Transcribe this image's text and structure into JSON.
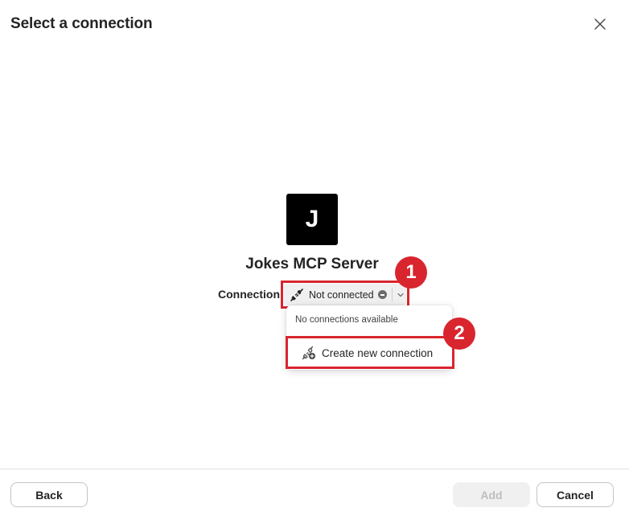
{
  "dialog": {
    "title": "Select a connection"
  },
  "server": {
    "logo_letter": "J",
    "name": "Jokes MCP Server"
  },
  "connection": {
    "label": "Connection",
    "status": "Not connected",
    "status_icon": "minus-circle-icon",
    "plug_icon": "plug-disconnected-icon"
  },
  "menu": {
    "empty_message": "No connections available",
    "create_label": "Create new connection",
    "create_icon": "plug-add-icon"
  },
  "annotations": {
    "badge_1": "1",
    "badge_2": "2",
    "highlight_color": "#d9252e"
  },
  "footer": {
    "back_label": "Back",
    "add_label": "Add",
    "cancel_label": "Cancel"
  }
}
